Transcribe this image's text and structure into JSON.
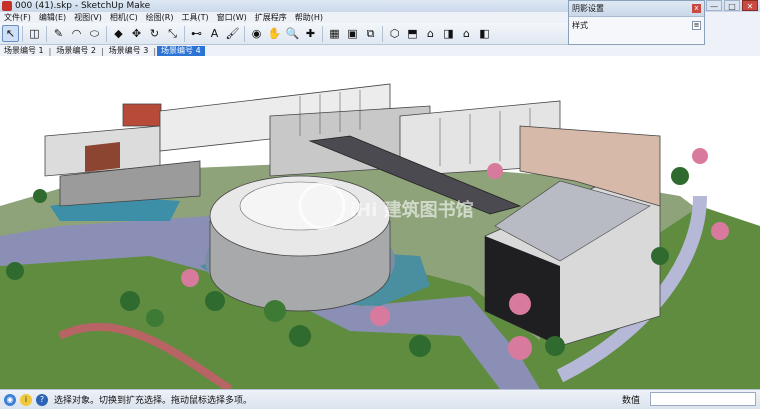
{
  "window": {
    "title": "000 (41).skp - SketchUp Make",
    "buttons": [
      "—",
      "□",
      "✕"
    ]
  },
  "menu": [
    "文件(F)",
    "编辑(E)",
    "视图(V)",
    "相机(C)",
    "绘图(R)",
    "工具(T)",
    "窗口(W)",
    "扩展程序",
    "帮助(H)"
  ],
  "toolbar": {
    "tools": [
      {
        "name": "select-icon",
        "glyph": "↖"
      },
      {
        "name": "eraser-icon",
        "glyph": "◫"
      },
      {
        "name": "pencil-icon",
        "glyph": "✎"
      },
      {
        "name": "arc-icon",
        "glyph": "◠"
      },
      {
        "name": "shape-icon",
        "glyph": "⬭"
      },
      {
        "name": "pushpull-icon",
        "glyph": "◆"
      },
      {
        "name": "move-icon",
        "glyph": "✥"
      },
      {
        "name": "rotate-icon",
        "glyph": "↻"
      },
      {
        "name": "scale-icon",
        "glyph": "⤡"
      },
      {
        "name": "tape-icon",
        "glyph": "⊷"
      },
      {
        "name": "text-icon",
        "glyph": "A"
      },
      {
        "name": "paint-icon",
        "glyph": "🖌"
      },
      {
        "name": "orbit-icon",
        "glyph": "◉"
      },
      {
        "name": "pan-icon",
        "glyph": "✋"
      },
      {
        "name": "zoom-icon",
        "glyph": "🔍"
      },
      {
        "name": "zoom-extents-icon",
        "glyph": "✚"
      },
      {
        "name": "warehouse-icon",
        "glyph": "▦"
      },
      {
        "name": "share-model-icon",
        "glyph": "▣"
      },
      {
        "name": "extension-icon",
        "glyph": "⧉"
      },
      {
        "name": "iso-view-icon",
        "glyph": "⬡"
      },
      {
        "name": "top-view-icon",
        "glyph": "⬒"
      },
      {
        "name": "front-view-icon",
        "glyph": "⌂"
      },
      {
        "name": "right-view-icon",
        "glyph": "◨"
      },
      {
        "name": "back-view-icon",
        "glyph": "⌂"
      },
      {
        "name": "left-view-icon",
        "glyph": "◧"
      }
    ]
  },
  "scenes": {
    "tabs": [
      "场景编号 1",
      "场景编号 2",
      "场景编号 3",
      "场景编号 4"
    ],
    "active_index": 3
  },
  "panel": {
    "title": "阴影设置",
    "section": "样式",
    "close": "x",
    "toggle": "≡"
  },
  "viewport": {
    "watermark": "iHi 建筑图书馆"
  },
  "status": {
    "message": "选择对象。切换到扩充选择。拖动鼠标选择多项。",
    "measure_label": "数值",
    "measure_value": ""
  }
}
